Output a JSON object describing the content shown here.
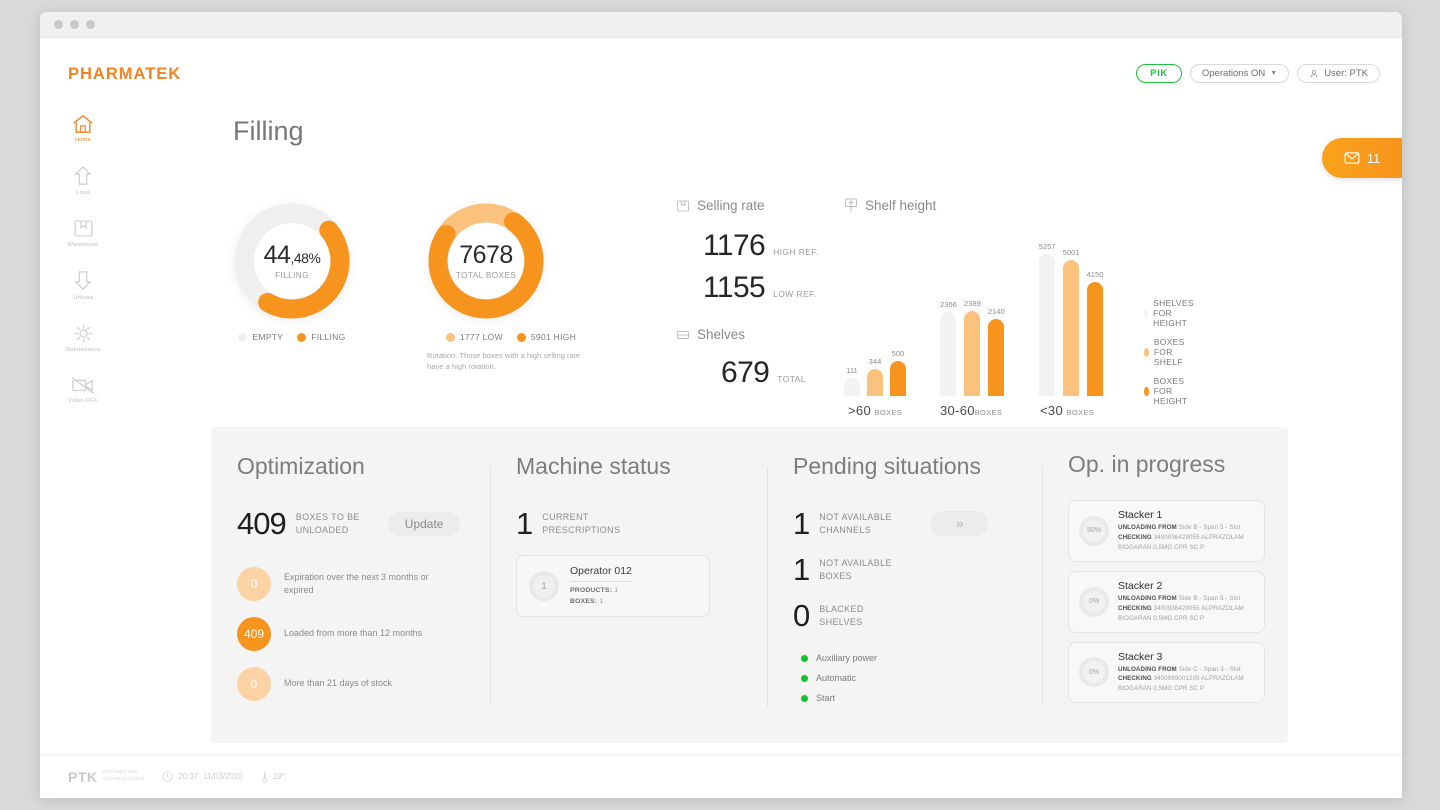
{
  "window": {
    "dots": 3
  },
  "brand": {
    "name": "PHARMATEK"
  },
  "header": {
    "page_title": "Filling",
    "pik_label": "PIK",
    "operations_label": "Operations ON",
    "user_label": "User: PTK",
    "mail_count": "11"
  },
  "sidebar": {
    "items": [
      {
        "label": "Home",
        "icon": "home-icon",
        "active": true
      },
      {
        "label": "Load",
        "icon": "arrow-up-icon",
        "active": false
      },
      {
        "label": "Warehouse",
        "icon": "box-icon",
        "active": false
      },
      {
        "label": "Unload",
        "icon": "arrow-down-icon",
        "active": false
      },
      {
        "label": "Maintenance",
        "icon": "gear-icon",
        "active": false
      },
      {
        "label": "Video OFF",
        "icon": "video-off-icon",
        "active": false
      }
    ]
  },
  "colors": {
    "orange": "#f7941d",
    "orange_light": "#fbc27e",
    "grey_bar": "#f2f2f2",
    "green": "#19c225",
    "brand": "#f58220"
  },
  "donuts": [
    {
      "id": "filling-donut",
      "value_main": "44",
      "value_decimal": ",48%",
      "caption": "FILLING",
      "percent": 44.48,
      "legend": [
        {
          "label": "EMPTY",
          "color": "#efefef"
        },
        {
          "label": "FILLING",
          "color": "#f7941d"
        }
      ],
      "note": ""
    },
    {
      "id": "total-boxes-donut",
      "value_main": "7678",
      "value_decimal": "",
      "caption": "TOTAL BOXES",
      "percent": 76.9,
      "legend": [
        {
          "label": "1777 LOW",
          "color": "#fbc27e"
        },
        {
          "label": "5901 HIGH",
          "color": "#f7941d"
        }
      ],
      "note": "Rotation. Those boxes with a high selling rate have a high rotation."
    }
  ],
  "selling_rate": {
    "title": "Selling rate",
    "icon": "box-icon",
    "rows": [
      {
        "value": "1176",
        "unit": "HIGH REF."
      },
      {
        "value": "1155",
        "unit": "LOW REF."
      }
    ]
  },
  "shelves": {
    "title": "Shelves",
    "icon": "shelf-icon",
    "value": "679",
    "unit": "TOTAL"
  },
  "chart_data": {
    "type": "bar",
    "title": "Shelf height",
    "icon": "shelf-height-icon",
    "categories": [
      ">60",
      "30-60",
      "<30"
    ],
    "category_unit": "BOXES",
    "series": [
      {
        "name": "SHELVES FOR HEIGHT",
        "color": "#f2f2f2",
        "values": [
          111,
          2366,
          5257
        ]
      },
      {
        "name": "BOXES FOR SHELF",
        "color": "#fbc27e",
        "values": [
          344,
          2389,
          5001
        ]
      },
      {
        "name": "BOXES FOR HEIGHT",
        "color": "#f7941d",
        "values": [
          500,
          2140,
          4150
        ]
      }
    ],
    "ylim": [
      0,
      5257
    ],
    "grid": false,
    "legend_position": "right",
    "xlabel": "",
    "ylabel": ""
  },
  "optimization": {
    "title": "Optimization",
    "kpi_value": "409",
    "kpi_label": "BOXES TO BE\nUNLOADED",
    "kpi_label_line1": "BOXES TO BE",
    "kpi_label_line2": "UNLOADED",
    "update_button": "Update",
    "bubbles": [
      {
        "value": "0",
        "color": "#fcd3a4",
        "text": "Expiration over the next 3 months or expired"
      },
      {
        "value": "409",
        "color": "#f7941d",
        "text": "Loaded from more than 12 months"
      },
      {
        "value": "0",
        "color": "#fcd3a4",
        "text": "More than 21 days of stock"
      }
    ]
  },
  "machine_status": {
    "title": "Machine status",
    "kpi_value": "1",
    "kpi_label_line1": "CURRENT",
    "kpi_label_line2": "PRESCRIPTIONS",
    "operator": {
      "badge": "1",
      "name": "Operator 012",
      "products_label": "PRODUCTS:",
      "products_value": "1",
      "boxes_label": "BOXES:",
      "boxes_value": "1"
    }
  },
  "pending": {
    "title": "Pending situations",
    "next_button": "»",
    "items": [
      {
        "value": "1",
        "line1": "NOT AVAILABLE",
        "line2": "CHANNELS"
      },
      {
        "value": "1",
        "line1": "NOT AVAILABLE",
        "line2": "BOXES"
      },
      {
        "value": "0",
        "line1": "BLACKED",
        "line2": "SHELVES"
      }
    ],
    "statuses": [
      {
        "label": "Auxiliary power",
        "color": "#19c225"
      },
      {
        "label": "Automatic",
        "color": "#19c225"
      },
      {
        "label": "Start",
        "color": "#19c225"
      }
    ]
  },
  "operations": {
    "title": "Op. in progress",
    "stackers": [
      {
        "name": "Stacker 1",
        "percent": "50%",
        "action_label": "UNLOADING FROM",
        "action_value": "Side B - Span 5 - Slot",
        "check_label": "CHECKING",
        "check_value": "3400936429055 ALPRAZOLAM",
        "detail": "BIOGARAN 0,5MG CPR SC P"
      },
      {
        "name": "Stacker 2",
        "percent": "0%",
        "action_label": "UNLOADING FROM",
        "action_value": "Side B - Span 5 - Slot",
        "check_label": "CHECKING",
        "check_value": "3400936429055 ALPRAZOLAM",
        "detail": "BIOGARAN 0,5MG CPR SC P"
      },
      {
        "name": "Stacker 3",
        "percent": "0%",
        "action_label": "UNLOADING FROM",
        "action_value": "Side C - Span 3 - Slot",
        "check_label": "CHECKING",
        "check_value": "3400969001205 ALPRAZOLAM",
        "detail": "BIOGARAN 0,5MG CPR SC P"
      }
    ]
  },
  "footer": {
    "logo": "PTK",
    "tagline_line1": "AUTOMATION",
    "tagline_line2": "TECHNOLOGIES",
    "time": "20:37",
    "date": "11/03/2020",
    "temperature": "19°"
  }
}
